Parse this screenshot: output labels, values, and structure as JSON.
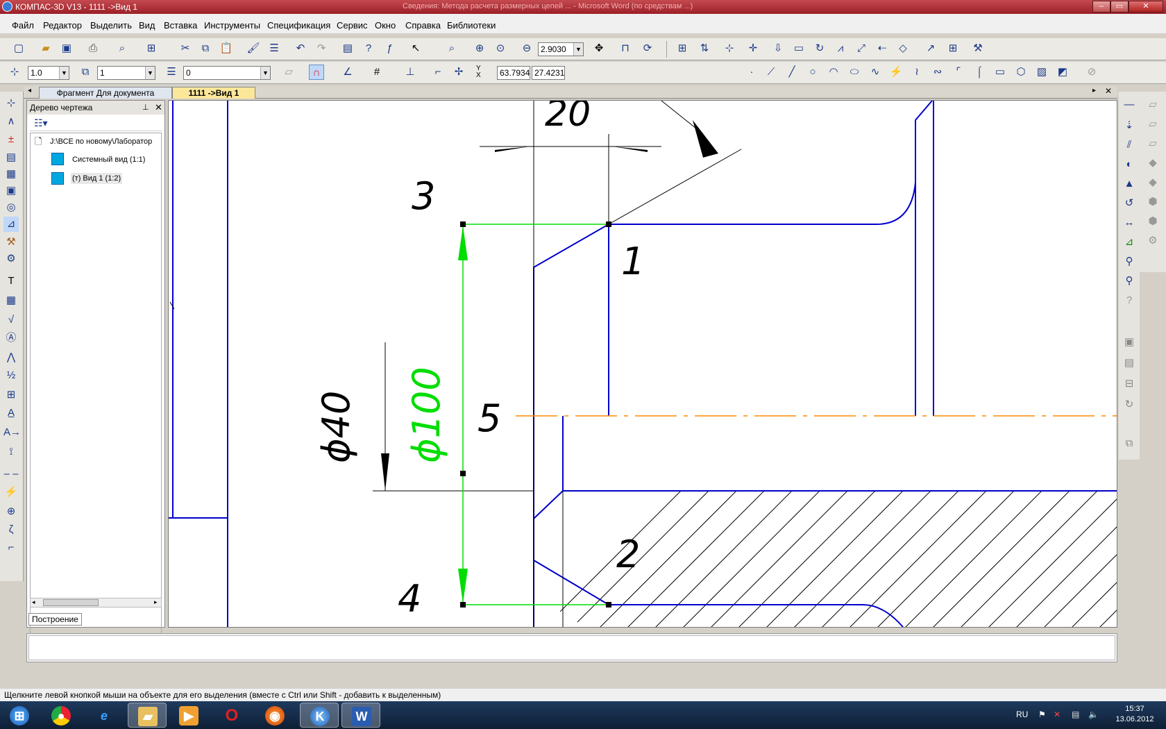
{
  "window": {
    "title": "КОМПАС-3D V13 - 1111 ->Вид 1",
    "subtitle": "Сведения: Метода расчета размерных цепей ...  - Microsoft Word (по средствам ...)"
  },
  "menu": [
    "Файл",
    "Редактор",
    "Выделить",
    "Вид",
    "Вставка",
    "Инструменты",
    "Спецификация",
    "Сервис",
    "Окно",
    "Справка",
    "Библиотеки"
  ],
  "toolbar": {
    "zoom_value": "2.9030",
    "line_scale": "1.0",
    "layer_value": "1",
    "style_value": "0",
    "coord_x": "63.7934",
    "coord_y": "27.4231"
  },
  "tabs": [
    {
      "label": "Фрагмент Для документа",
      "active": false
    },
    {
      "label": "1111 ->Вид 1",
      "active": true
    }
  ],
  "tree": {
    "header": "Дерево чертежа",
    "root": "J:\\ВСЕ по новому\\Лаборатор",
    "items": [
      "Системный вид (1:1)",
      "(т) Вид 1 (1:2)"
    ],
    "footer_tab": "Построение"
  },
  "drawing": {
    "labels": [
      "20",
      "3",
      "1",
      "5",
      "2",
      "4",
      "ϕ40",
      "ϕ100"
    ],
    "colors": {
      "contour": "#0000cc",
      "selected": "#00dd00",
      "axis": "#ff8800",
      "dim": "#000000"
    }
  },
  "status": {
    "hint": "Щелкните левой кнопкой мыши на объекте для его выделения (вместе с Ctrl или Shift - добавить к выделенным)"
  },
  "tray": {
    "lang": "RU",
    "time": "15:37",
    "date": "13.06.2012"
  },
  "taskbar": {
    "apps": [
      "start",
      "chrome",
      "ie",
      "explorer",
      "media",
      "opera",
      "firefox",
      "kompas",
      "word"
    ]
  }
}
